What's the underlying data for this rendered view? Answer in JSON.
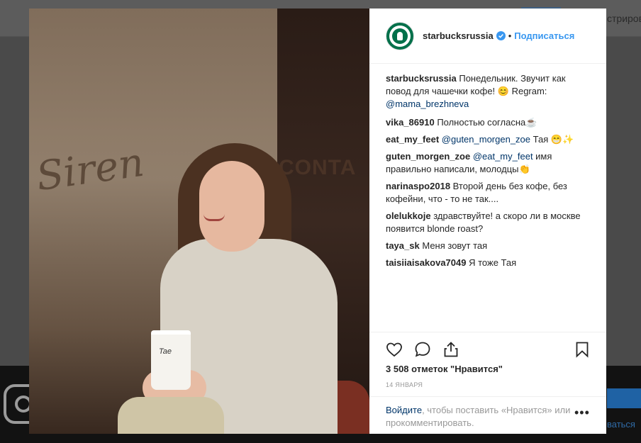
{
  "background": {
    "right_text": "стриров",
    "footer_link": "ваться"
  },
  "post": {
    "username": "starbucksrussia",
    "follow_label": "Подписаться",
    "dot": "•",
    "photo_cup_text": "Tae",
    "caption": {
      "user": "starbucksrussia",
      "text": "Понедельник. Звучит как повод для чашечки кофе! 😊 Regram: ",
      "mention": "@mama_brezhneva"
    },
    "comments": [
      {
        "user": "vika_86910",
        "text": "Полностью согласна☕"
      },
      {
        "user": "eat_my_feet",
        "mention": "@guten_morgen_zoe",
        "text": " Тая 😁✨"
      },
      {
        "user": "guten_morgen_zoe",
        "mention": "@eat_my_feet",
        "text": " имя правильно написали, молодцы👏"
      },
      {
        "user": "narinaspo2018",
        "text": "Второй день без кофе, без кофейни, что - то не так...."
      },
      {
        "user": "olelukkoje",
        "text": "здравствуйте! а скоро ли в москве появится blonde roast?"
      },
      {
        "user": "taya_sk",
        "text": "Меня зовут тая"
      },
      {
        "user": "taisiiaisakova7049",
        "text": "Я тоже Тая"
      }
    ],
    "likes": "3 508 отметок \"Нравится\"",
    "date": "14 ЯНВАРЯ",
    "login_link": "Войдите",
    "login_text": ", чтобы поставить «Нравится» или прокомментировать.",
    "more": "•••"
  },
  "icons": {
    "like": "heart-icon",
    "comment": "comment-icon",
    "share": "share-icon",
    "save": "bookmark-icon"
  },
  "colors": {
    "link": "#3897f0",
    "mention": "#003569",
    "starbucks_green": "#00704a"
  }
}
